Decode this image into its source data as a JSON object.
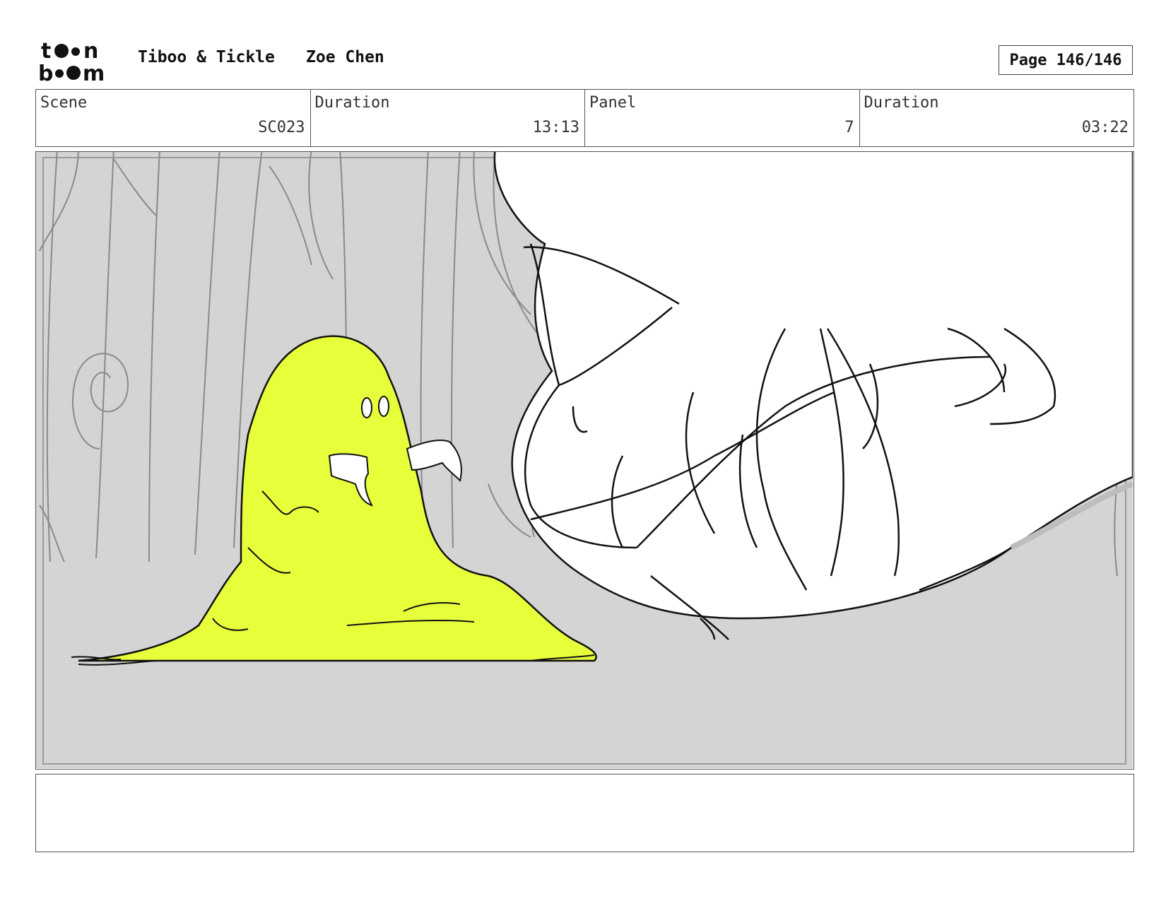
{
  "header": {
    "logo_text": "toon boom",
    "project": "Tiboo & Tickle",
    "author": "Zoe Chen",
    "page": "Page 146/146"
  },
  "info": {
    "scene_label": "Scene",
    "scene_value": "SC023",
    "scene_duration_label": "Duration",
    "scene_duration_value": "13:13",
    "panel_label": "Panel",
    "panel_value": "7",
    "panel_duration_label": "Duration",
    "panel_duration_value": "03:22"
  },
  "panel": {
    "background_color": "#d4d4d4",
    "slime_color": "#e6ff3a"
  },
  "notes": {
    "text": ""
  }
}
